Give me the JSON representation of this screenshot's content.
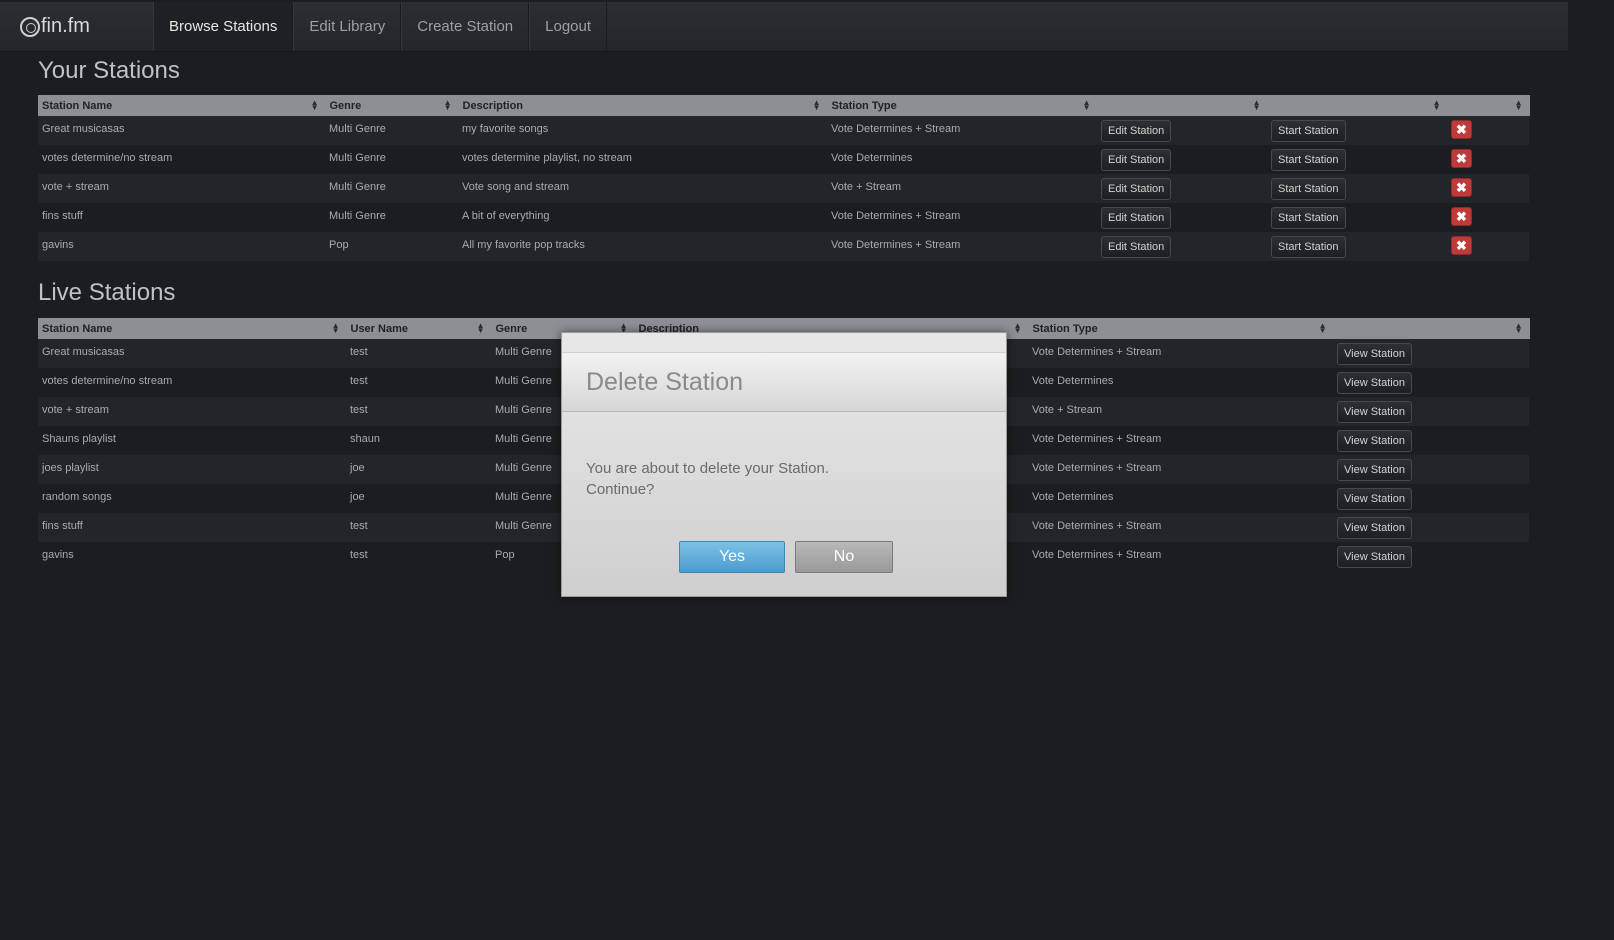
{
  "brand": {
    "name": "fin.fm"
  },
  "nav": {
    "items": [
      "Browse Stations",
      "Edit Library",
      "Create Station",
      "Logout"
    ]
  },
  "your_stations": {
    "title": "Your Stations",
    "headers": [
      "Station Name",
      "Genre",
      "Description",
      "Station Type",
      "",
      "",
      ""
    ],
    "edit_label": "Edit Station",
    "start_label": "Start Station",
    "delete_glyph": "✖",
    "rows": [
      [
        "Great musicasas",
        "Multi Genre",
        "my favorite songs",
        "Vote Determines + Stream"
      ],
      [
        "votes determine/no stream",
        "Multi Genre",
        "votes determine playlist, no stream",
        "Vote Determines"
      ],
      [
        "vote + stream",
        "Multi Genre",
        "Vote song and stream",
        "Vote + Stream"
      ],
      [
        "fins stuff",
        "Multi Genre",
        "A bit of everything",
        "Vote Determines + Stream"
      ],
      [
        "gavins",
        "Pop",
        "All my favorite pop tracks",
        "Vote Determines + Stream"
      ]
    ]
  },
  "live_stations": {
    "title": "Live Stations",
    "headers": [
      "Station Name",
      "User Name",
      "Genre",
      "Description",
      "Station Type",
      ""
    ],
    "view_label": "View Station",
    "rows": [
      [
        "Great musicasas",
        "test",
        "Multi Genre",
        "",
        "Vote Determines + Stream"
      ],
      [
        "votes determine/no stream",
        "test",
        "Multi Genre",
        "",
        "Vote Determines"
      ],
      [
        "vote + stream",
        "test",
        "Multi Genre",
        "",
        "Vote + Stream"
      ],
      [
        "Shauns playlist",
        "shaun",
        "Multi Genre",
        "",
        "Vote Determines + Stream"
      ],
      [
        "joes playlist",
        "joe",
        "Multi Genre",
        "",
        "Vote Determines + Stream"
      ],
      [
        "random songs",
        "joe",
        "Multi Genre",
        "",
        "Vote Determines"
      ],
      [
        "fins stuff",
        "test",
        "Multi Genre",
        "",
        "Vote Determines + Stream"
      ],
      [
        "gavins",
        "test",
        "Pop",
        "",
        "Vote Determines + Stream"
      ]
    ]
  },
  "modal": {
    "title": "Delete Station",
    "message_line1": "You are about to delete your Station.",
    "message_line2": "Continue?",
    "yes_label": "Yes",
    "no_label": "No"
  },
  "colors": {
    "background": "#1b1d20",
    "table_header": "#8c8f93",
    "delete_button": "#bf3a3a",
    "yes_button": "#4a9ccd"
  }
}
